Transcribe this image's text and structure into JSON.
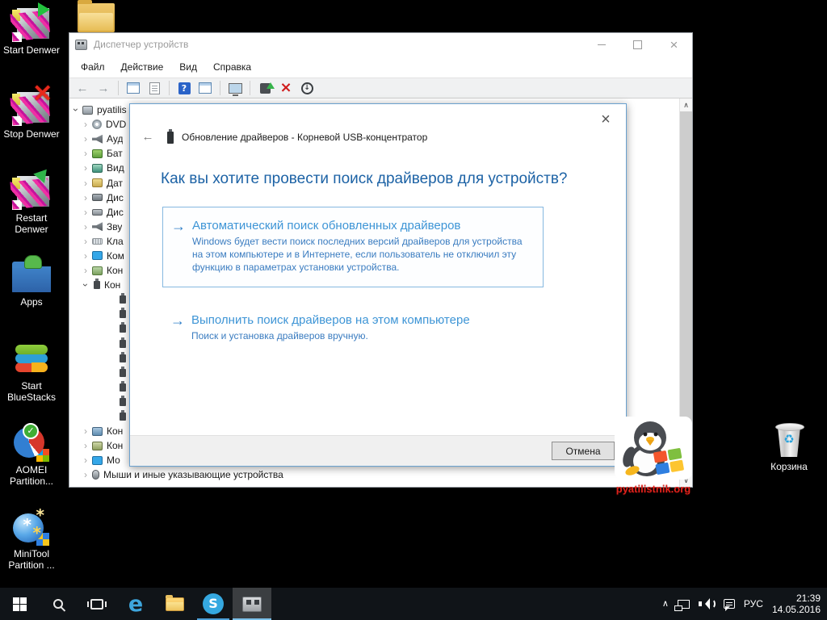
{
  "desktop": {
    "icons": [
      {
        "label": "Start Denwer",
        "kind": "k-denstart"
      },
      {
        "label": "Stop Denwer",
        "kind": "k-denstop"
      },
      {
        "label": "Restart Denwer",
        "kind": "k-denrestart"
      },
      {
        "label": "Apps",
        "kind": "k-apps"
      },
      {
        "label": "Start BlueStacks",
        "kind": "k-bluestacks"
      },
      {
        "label": "AOMEI Partition...",
        "kind": "k-aomei"
      },
      {
        "label": "MiniTool Partition ...",
        "kind": "k-minitool"
      }
    ],
    "recycle_bin": {
      "label": "Корзина"
    }
  },
  "device_manager": {
    "title": "Диспетчер устройств",
    "menus": [
      "Файл",
      "Действие",
      "Вид",
      "Справка"
    ],
    "tree": {
      "items": [
        {
          "expander": "e-exp",
          "icon": "ic-computer",
          "label": "pyatilis",
          "indent": "ind0"
        },
        {
          "expander": "e-col",
          "icon": "ic-dvd",
          "label": "DVD",
          "indent": "ind1"
        },
        {
          "expander": "e-col",
          "icon": "ic-audio",
          "label": "Ауд",
          "indent": "ind1"
        },
        {
          "expander": "e-col",
          "icon": "ic-battery",
          "label": "Бат",
          "indent": "ind1"
        },
        {
          "expander": "e-col",
          "icon": "ic-video",
          "label": "Вид",
          "indent": "ind1"
        },
        {
          "expander": "e-col",
          "icon": "ic-sensor",
          "label": "Дат",
          "indent": "ind1"
        },
        {
          "expander": "e-col",
          "icon": "ic-disk",
          "label": "Дис",
          "indent": "ind1"
        },
        {
          "expander": "e-col",
          "icon": "ic-drive",
          "label": "Дис",
          "indent": "ind1"
        },
        {
          "expander": "e-col",
          "icon": "ic-sound",
          "label": "Зву",
          "indent": "ind1"
        },
        {
          "expander": "e-col",
          "icon": "ic-keyboard",
          "label": "Кла",
          "indent": "ind1"
        },
        {
          "expander": "e-col",
          "icon": "ic-monitor",
          "label": "Ком",
          "indent": "ind1"
        },
        {
          "expander": "e-col",
          "icon": "ic-chip",
          "label": "Кон",
          "indent": "ind1"
        },
        {
          "expander": "e-exp",
          "icon": "ic-usb",
          "label": "Кон",
          "indent": "ind1"
        },
        {
          "expander": "e-none",
          "icon": "ic-usb",
          "label": "",
          "indent": "ind2"
        },
        {
          "expander": "e-none",
          "icon": "ic-usb",
          "label": "",
          "indent": "ind2"
        },
        {
          "expander": "e-none",
          "icon": "ic-usb",
          "label": "",
          "indent": "ind2"
        },
        {
          "expander": "e-none",
          "icon": "ic-usb",
          "label": "",
          "indent": "ind2"
        },
        {
          "expander": "e-none",
          "icon": "ic-usb",
          "label": "",
          "indent": "ind2"
        },
        {
          "expander": "e-none",
          "icon": "ic-usb",
          "label": "",
          "indent": "ind2"
        },
        {
          "expander": "e-none",
          "icon": "ic-usb",
          "label": "",
          "indent": "ind2"
        },
        {
          "expander": "e-none",
          "icon": "ic-usb",
          "label": "",
          "indent": "ind2"
        },
        {
          "expander": "e-none",
          "icon": "ic-usb",
          "label": "",
          "indent": "ind2"
        },
        {
          "expander": "e-col",
          "icon": "ic-card",
          "label": "Кон",
          "indent": "ind1"
        },
        {
          "expander": "e-col",
          "icon": "ic-card2",
          "label": "Кон",
          "indent": "ind1"
        },
        {
          "expander": "e-col",
          "icon": "ic-monitor",
          "label": "Мо",
          "indent": "ind1"
        },
        {
          "expander": "e-col",
          "icon": "ic-mouse",
          "label": "Мыши и иные указывающие устройства",
          "indent": "ind1"
        }
      ]
    }
  },
  "dialog": {
    "title": "Обновление драйверов - Корневой USB-концентратор",
    "heading": "Как вы хотите провести поиск драйверов для устройств?",
    "options": [
      {
        "title": "Автоматический поиск обновленных драйверов",
        "desc": "Windows будет вести поиск последних версий драйверов для устройства на этом компьютере и в Интернете, если пользователь не отключил эту функцию в параметрах установки устройства."
      },
      {
        "title": "Выполнить поиск драйверов на этом компьютере",
        "desc": "Поиск и установка драйверов вручную."
      }
    ],
    "cancel_label": "Отмена"
  },
  "watermark": {
    "site": "pyatilistnik.org"
  },
  "taskbar": {
    "tray": {
      "lang": "РУС",
      "time": "21:39",
      "date": "14.05.2016"
    }
  },
  "icons": {
    "close": "×",
    "minimize": "–",
    "maximize": "□",
    "back-arrow": "←",
    "forward-arrow": "→",
    "option-arrow": "→",
    "expander": "›",
    "help": "?",
    "uninstall": "×",
    "disable-arrow": "↓",
    "tray-chevron": "∧",
    "scroll-up": "∧",
    "scroll-down": "∨",
    "recycle": "♻",
    "skype-letter": "S",
    "edge-letter": "e",
    "check": "✓"
  }
}
